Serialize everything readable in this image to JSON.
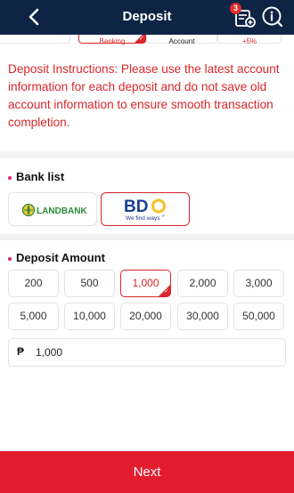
{
  "header": {
    "title": "Deposit",
    "notification_count": "3",
    "icons": [
      "back-chevron-icon",
      "deposit-record-icon",
      "help-info-icon"
    ]
  },
  "methods": {
    "tabs": [
      {
        "label": "",
        "selected": false
      },
      {
        "label": "Banking",
        "selected": true
      },
      {
        "label": "Account",
        "selected": false
      },
      {
        "label": "+5%",
        "selected": false
      }
    ]
  },
  "instructions": {
    "text": "Deposit Instructions: Please use the latest account information for each deposit and do not save old account information to ensure smooth transaction completion."
  },
  "bank_list": {
    "title": "Bank list",
    "banks": [
      {
        "name": "LANDBANK",
        "selected": false
      },
      {
        "name": "BDO",
        "tagline": "We find ways",
        "selected": true
      }
    ]
  },
  "deposit_amount": {
    "title": "Deposit Amount",
    "options": [
      "200",
      "500",
      "1,000",
      "2,000",
      "3,000",
      "5,000",
      "10,000",
      "20,000",
      "30,000",
      "50,000"
    ],
    "selected": "1,000",
    "currency_symbol": "₱",
    "input_value": "1,000"
  },
  "footer": {
    "next_label": "Next"
  },
  "colors": {
    "header_bg": "#0e2445",
    "accent_red": "#d9262b",
    "button_red": "#e41d2e",
    "section_dot": "#d9267a"
  }
}
